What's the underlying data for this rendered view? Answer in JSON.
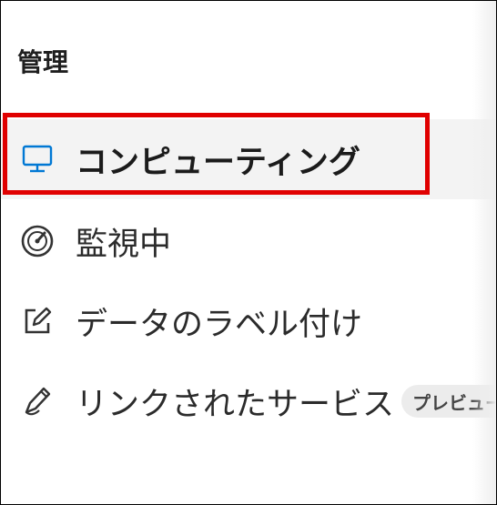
{
  "section": {
    "title": "管理"
  },
  "nav": {
    "items": [
      {
        "label": "コンピューティング",
        "icon": "monitor-icon",
        "selected": true
      },
      {
        "label": "監視中",
        "icon": "gauge-icon",
        "selected": false
      },
      {
        "label": "データのラベル付け",
        "icon": "edit-box-icon",
        "selected": false
      },
      {
        "label": "リンクされたサービス",
        "icon": "link-pen-icon",
        "selected": false,
        "badge": "プレビュー"
      }
    ]
  },
  "colors": {
    "highlight": "#e00000",
    "accent_icon": "#0078d4",
    "selected_bg": "#f3f3f3"
  }
}
